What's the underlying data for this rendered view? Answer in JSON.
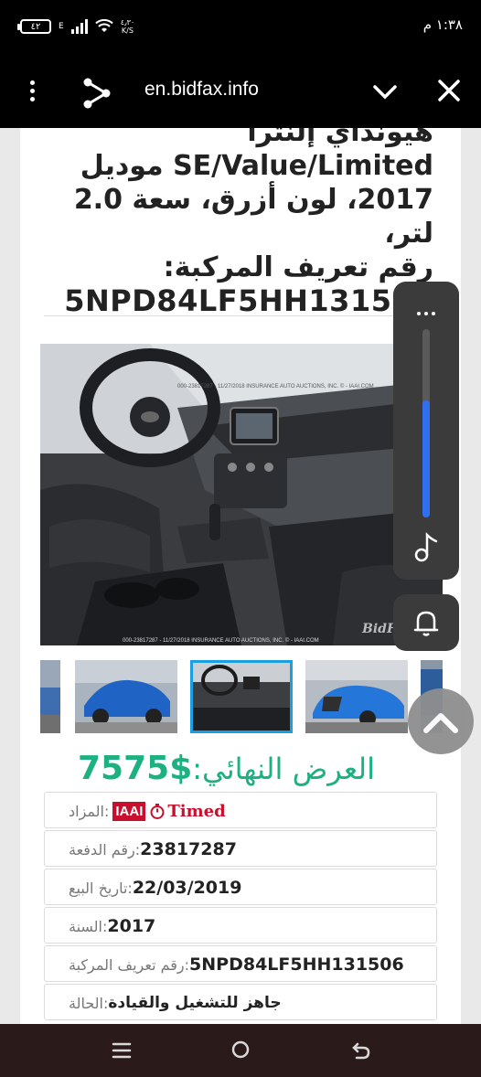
{
  "status_bar": {
    "time": "١:٣٨ م",
    "battery": "٤٢",
    "network": "E",
    "speed_value": "٤٫٣٠",
    "speed_unit": "K/S"
  },
  "browser": {
    "url": "en.bidfax.info"
  },
  "listing": {
    "title_top": "هيونداي إلنترا",
    "title_model": "SE/Value/Limited موديل",
    "title_specs": "2017، لون أزرق، سعة 2.0 لتر،",
    "title_vin_label": "رقم تعريف المركبة:",
    "title_vin": "5NPD84LF5HH131506"
  },
  "images": {
    "watermark_top": "000-23817287 - 11/27/2018 INSURANCE AUTO AUCTIONS, INC. © - IAAI.COM",
    "watermark_bottom": "000-23817287 - 11/27/2018 INSURANCE AUTO AUCTIONS, INC. © - IAAI.COM",
    "watermark_logo": "BidF"
  },
  "price": {
    "amount": "$7575",
    "label": "العرض النهائي:"
  },
  "details": {
    "auction_label": "المزاد:",
    "auction_badge": "IAAI",
    "auction_type": "Timed",
    "lot_label": "رقم الدفعة:",
    "lot_value": "23817287",
    "sale_date_label": "تاريخ البيع:",
    "sale_date_value": "22/03/2019",
    "year_label": "السنة:",
    "year_value": "2017",
    "vin_label": "رقم تعريف المركبة:",
    "vin_value": "5NPD84LF5HH131506",
    "condition_label": "الحالة:",
    "condition_value": "جاهز للتشغيل والقيادة"
  },
  "volume_panel": {
    "level": 0.62,
    "accent": "#2f6ff0"
  },
  "colors": {
    "price_green": "#1db081",
    "iaai_red": "#c8102e",
    "selected_thumb": "#1aa0e0"
  }
}
